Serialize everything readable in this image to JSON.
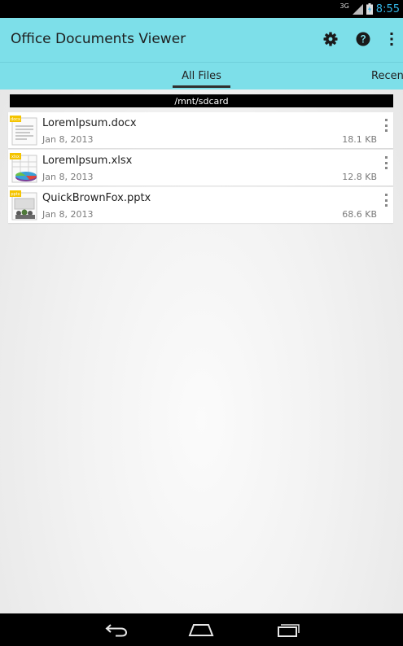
{
  "status_bar": {
    "network_label": "3G",
    "time": "8:55",
    "signal_icon": "signal-icon",
    "battery_icon": "battery-charging-icon"
  },
  "action_bar": {
    "title": "Office Documents Viewer",
    "icons": [
      "settings-icon",
      "help-icon",
      "overflow-menu-icon"
    ],
    "background": "#7ddfe9"
  },
  "tabs": [
    {
      "label": "All Files",
      "selected": true
    },
    {
      "label": "Recent",
      "selected": false
    }
  ],
  "path": "/mnt/sdcard",
  "files": [
    {
      "name": "LoremIpsum.docx",
      "date": "Jan 8, 2013",
      "size": "18.1 KB",
      "icon": "docx-file-icon",
      "badge": "docx"
    },
    {
      "name": "LoremIpsum.xlsx",
      "date": "Jan 8, 2013",
      "size": "12.8 KB",
      "icon": "xlsx-file-icon",
      "badge": "xlsx"
    },
    {
      "name": "QuickBrownFox.pptx",
      "date": "Jan 8, 2013",
      "size": "68.6 KB",
      "icon": "pptx-file-icon",
      "badge": "pptx"
    }
  ],
  "nav_bar": {
    "buttons": [
      "back-icon",
      "home-icon",
      "recent-apps-icon"
    ]
  }
}
